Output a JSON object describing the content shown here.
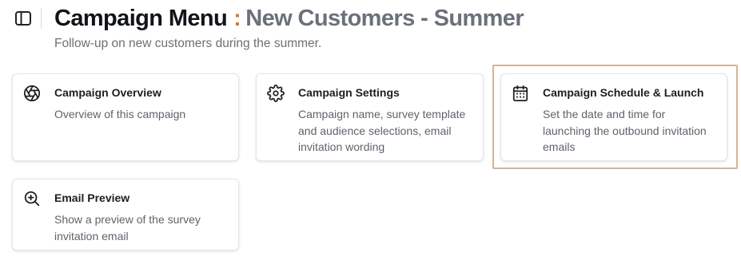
{
  "header": {
    "title_main": "Campaign Menu",
    "title_sep": ":",
    "title_campaign": "New Customers - Summer",
    "subtitle": "Follow-up on new customers during the summer.",
    "sidebar_toggle_icon": "sidebar-toggle-icon"
  },
  "accent_color": "#e07a2a",
  "selection_color": "#d3b497",
  "cards": [
    {
      "icon": "aperture-icon",
      "title": "Campaign Overview",
      "description": "Overview of this campaign"
    },
    {
      "icon": "gear-icon",
      "title": "Campaign Settings",
      "description": "Campaign name, survey template and audience selections, email invitation wording"
    },
    {
      "icon": "calendar-icon",
      "title": "Campaign Schedule & Launch",
      "description": "Set the date and time for launching the outbound invitation emails",
      "selected": true
    },
    {
      "icon": "zoom-in-icon",
      "title": "Email Preview",
      "description": "Show a preview of the survey invitation email"
    }
  ]
}
